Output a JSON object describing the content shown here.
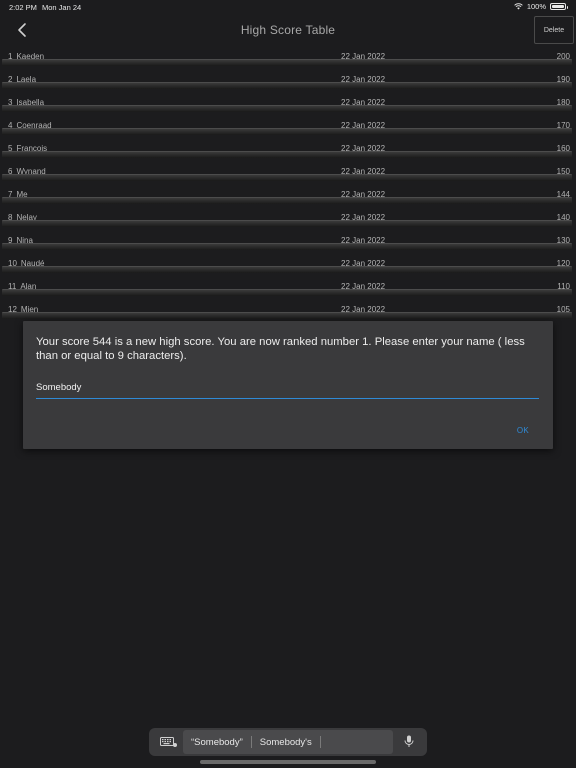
{
  "status_bar": {
    "time": "2:02 PM",
    "date": "Mon Jan 24",
    "battery": "100%"
  },
  "nav": {
    "title": "High Score Table",
    "delete_label": "Delete"
  },
  "scores": [
    {
      "rank": "1",
      "name": "Kaeden",
      "date": "22 Jan 2022",
      "score": "200"
    },
    {
      "rank": "2",
      "name": "Laela",
      "date": "22 Jan 2022",
      "score": "190"
    },
    {
      "rank": "3",
      "name": "Isabella",
      "date": "22 Jan 2022",
      "score": "180"
    },
    {
      "rank": "4",
      "name": "Coenraad",
      "date": "22 Jan 2022",
      "score": "170"
    },
    {
      "rank": "5",
      "name": "Francois",
      "date": "22 Jan 2022",
      "score": "160"
    },
    {
      "rank": "6",
      "name": "Wynand",
      "date": "22 Jan 2022",
      "score": "150"
    },
    {
      "rank": "7",
      "name": "Me",
      "date": "22 Jan 2022",
      "score": "144"
    },
    {
      "rank": "8",
      "name": "Nelay",
      "date": "22 Jan 2022",
      "score": "140"
    },
    {
      "rank": "9",
      "name": "Nina",
      "date": "22 Jan 2022",
      "score": "130"
    },
    {
      "rank": "10",
      "name": "Naudé",
      "date": "22 Jan 2022",
      "score": "120"
    },
    {
      "rank": "11",
      "name": "Alan",
      "date": "22 Jan 2022",
      "score": "110"
    },
    {
      "rank": "12",
      "name": "Mien",
      "date": "22 Jan 2022",
      "score": "105"
    }
  ],
  "dialog": {
    "message": "Your score 544 is a new high score. You are now ranked number 1. Please enter your name ( less than or equal to 9 characters).",
    "input_value": "Somebody",
    "ok_label": "OK"
  },
  "keyboard": {
    "suggestions": [
      "“Somebody”",
      "Somebody's"
    ]
  },
  "colors": {
    "accent": "#2f8ad6",
    "background": "#1c1c1e",
    "dialog": "#3a3a3c"
  }
}
